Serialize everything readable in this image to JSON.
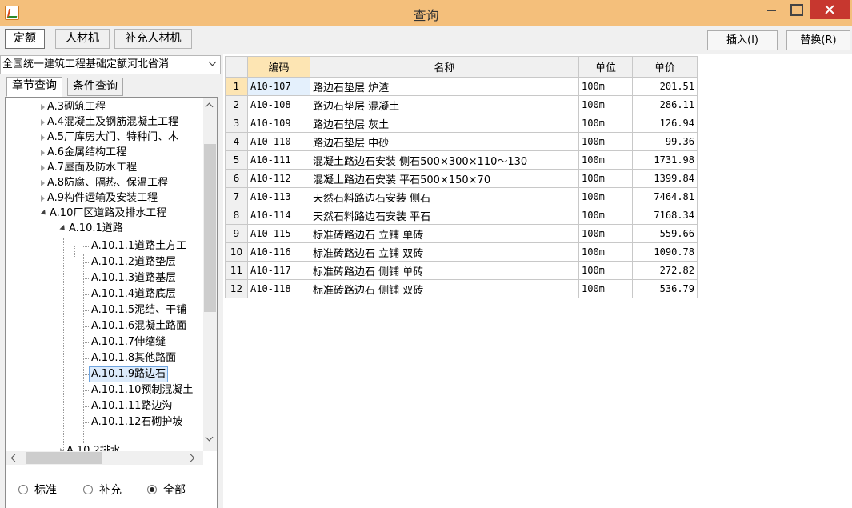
{
  "window": {
    "title": "查询"
  },
  "top_tabs": [
    "定额",
    "人材机",
    "补充人材机"
  ],
  "actions": {
    "insert": "插入(I)",
    "replace": "替换(R)"
  },
  "left": {
    "combo_value": "全国统一建筑工程基础定额河北省消",
    "subtabs": [
      "章节查询",
      "条件查询"
    ],
    "tree": [
      "A.3砌筑工程",
      "A.4混凝土及钢筋混凝土工程",
      "A.5厂库房大门、特种门、木",
      "A.6金属结构工程",
      "A.7屋面及防水工程",
      "A.8防腐、隔热、保温工程",
      "A.9构件运输及安装工程",
      "A.10厂区道路及排水工程",
      "A.10.1道路",
      "A.10.1.1道路土方工",
      "A.10.1.2道路垫层",
      "A.10.1.3道路基层",
      "A.10.1.4道路底层",
      "A.10.1.5泥结、干铺",
      "A.10.1.6混凝土路面",
      "A.10.1.7伸缩缝",
      "A.10.1.8其他路面",
      "A.10.1.9路边石",
      "A.10.1.10预制混凝土",
      "A.10.1.11路边沟",
      "A.10.1.12石砌护坡",
      "A.10.2排水"
    ],
    "radios": [
      "标准",
      "补充",
      "全部"
    ],
    "radio_selected": "全部"
  },
  "grid": {
    "columns": [
      "编码",
      "名称",
      "单位",
      "单价"
    ],
    "rows": [
      [
        "1",
        "A10-107",
        "路边石垫层 炉渣",
        "100m",
        "201.51"
      ],
      [
        "2",
        "A10-108",
        "路边石垫层 混凝土",
        "100m",
        "286.11"
      ],
      [
        "3",
        "A10-109",
        "路边石垫层 灰土",
        "100m",
        "126.94"
      ],
      [
        "4",
        "A10-110",
        "路边石垫层 中砂",
        "100m",
        "99.36"
      ],
      [
        "5",
        "A10-111",
        "混凝土路边石安装 侧石500×300×110～130",
        "100m",
        "1731.98"
      ],
      [
        "6",
        "A10-112",
        "混凝土路边石安装 平石500×150×70",
        "100m",
        "1399.84"
      ],
      [
        "7",
        "A10-113",
        "天然石料路边石安装 侧石",
        "100m",
        "7464.81"
      ],
      [
        "8",
        "A10-114",
        "天然石料路边石安装 平石",
        "100m",
        "7168.34"
      ],
      [
        "9",
        "A10-115",
        "标准砖路边石 立铺 单砖",
        "100m",
        "559.66"
      ],
      [
        "10",
        "A10-116",
        "标准砖路边石 立铺 双砖",
        "100m",
        "1090.78"
      ],
      [
        "11",
        "A10-117",
        "标准砖路边石 侧铺 单砖",
        "100m",
        "272.82"
      ],
      [
        "12",
        "A10-118",
        "标准砖路边石 侧铺 双砖",
        "100m",
        "536.79"
      ]
    ]
  }
}
